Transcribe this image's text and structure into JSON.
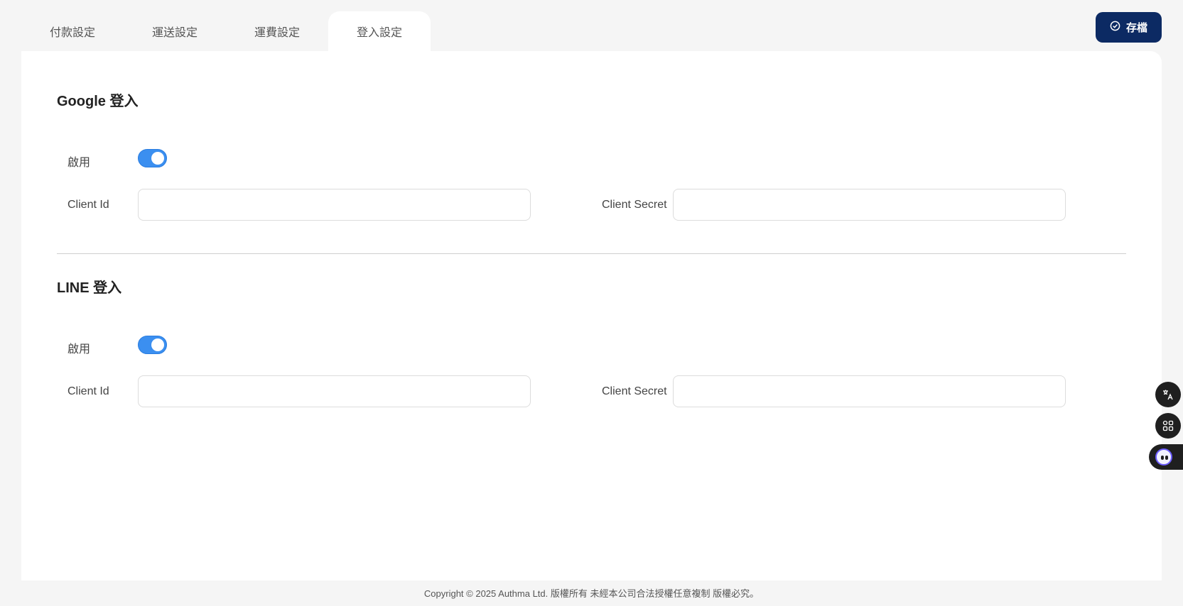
{
  "tabs": [
    {
      "label": "付款設定"
    },
    {
      "label": "運送設定"
    },
    {
      "label": "運費設定"
    },
    {
      "label": "登入設定",
      "active": true
    }
  ],
  "toolbar": {
    "save_label": "存檔",
    "save_icon": "check-circle-icon"
  },
  "sections": {
    "google": {
      "title": "Google 登入",
      "enable_label": "啟用",
      "enabled": true,
      "client_id_label": "Client Id",
      "client_id_value": "",
      "client_secret_label": "Client Secret",
      "client_secret_value": ""
    },
    "line": {
      "title": "LINE 登入",
      "enable_label": "啟用",
      "enabled": true,
      "client_id_label": "Client Id",
      "client_id_value": "",
      "client_secret_label": "Client Secret",
      "client_secret_value": ""
    }
  },
  "footer": {
    "copyright": "Copyright © 2025 Authma Ltd. 版權所有 未經本公司合法授權任意複制 版權必究。"
  },
  "floating": {
    "icons": [
      "translate-icon",
      "apps-grid-icon",
      "assistant-icon"
    ]
  },
  "colors": {
    "accent": "#3b8ff0",
    "save_button": "#0c2a63",
    "background": "#f5f5f5"
  }
}
